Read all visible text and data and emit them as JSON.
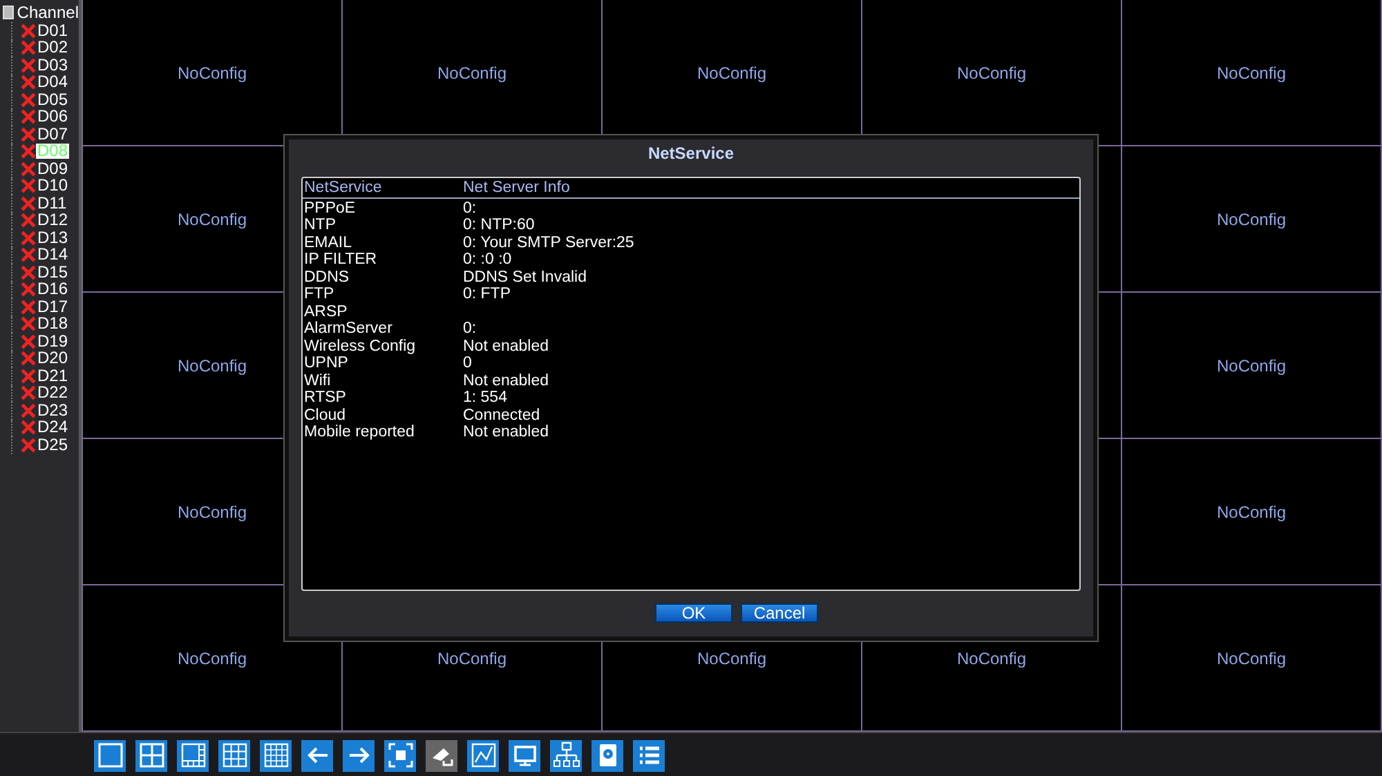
{
  "channel_tree": {
    "title": "Channel",
    "items": [
      {
        "label": "D01",
        "selected": false
      },
      {
        "label": "D02",
        "selected": false
      },
      {
        "label": "D03",
        "selected": false
      },
      {
        "label": "D04",
        "selected": false
      },
      {
        "label": "D05",
        "selected": false
      },
      {
        "label": "D06",
        "selected": false
      },
      {
        "label": "D07",
        "selected": false
      },
      {
        "label": "D08",
        "selected": true
      },
      {
        "label": "D09",
        "selected": false
      },
      {
        "label": "D10",
        "selected": false
      },
      {
        "label": "D11",
        "selected": false
      },
      {
        "label": "D12",
        "selected": false
      },
      {
        "label": "D13",
        "selected": false
      },
      {
        "label": "D14",
        "selected": false
      },
      {
        "label": "D15",
        "selected": false
      },
      {
        "label": "D16",
        "selected": false
      },
      {
        "label": "D17",
        "selected": false
      },
      {
        "label": "D18",
        "selected": false
      },
      {
        "label": "D19",
        "selected": false
      },
      {
        "label": "D20",
        "selected": false
      },
      {
        "label": "D21",
        "selected": false
      },
      {
        "label": "D22",
        "selected": false
      },
      {
        "label": "D23",
        "selected": false
      },
      {
        "label": "D24",
        "selected": false
      },
      {
        "label": "D25",
        "selected": false
      }
    ]
  },
  "video_grid": {
    "cells": [
      {
        "label": "NoConfig"
      },
      {
        "label": "NoConfig"
      },
      {
        "label": "NoConfig"
      },
      {
        "label": "NoConfig"
      },
      {
        "label": "NoConfig"
      },
      {
        "label": "NoConfig"
      },
      null,
      null,
      {},
      {
        "label": "NoConfig"
      },
      {
        "label": "NoConfig"
      },
      null,
      null,
      {},
      {
        "label": "NoConfig"
      },
      {
        "label": "NoConfig"
      },
      null,
      null,
      {},
      {
        "label": "NoConfig"
      },
      {
        "label": "NoConfig"
      },
      {
        "label": "NoConfig"
      },
      {
        "label": "NoConfig"
      },
      {
        "label": "NoConfig"
      },
      {
        "label": "NoConfig"
      }
    ]
  },
  "toolbar": [
    {
      "disabled": false
    },
    {
      "disabled": false
    },
    {
      "disabled": false
    },
    {
      "disabled": false
    },
    {
      "disabled": false
    },
    {
      "disabled": false
    },
    {
      "disabled": false
    },
    {
      "disabled": false
    },
    {
      "disabled": true
    },
    {
      "disabled": false
    },
    {
      "disabled": false
    },
    {
      "disabled": false
    },
    {
      "disabled": false
    },
    {
      "disabled": false
    }
  ],
  "dialog": {
    "title": "NetService",
    "columns": [
      "NetService",
      "Net Server Info"
    ],
    "rows": [
      {
        "service": "PPPoE",
        "info": "0:"
      },
      {
        "service": "NTP",
        "info": "0: NTP:60"
      },
      {
        "service": "EMAIL",
        "info": "0: Your SMTP Server:25"
      },
      {
        "service": "IP FILTER",
        "info": "0: :0 :0"
      },
      {
        "service": "DDNS",
        "info": "DDNS Set Invalid"
      },
      {
        "service": "FTP",
        "info": "0: FTP"
      },
      {
        "service": "ARSP"
      },
      {
        "service": "AlarmServer",
        "info": "0:"
      },
      {
        "service": "Wireless Config",
        "info": "Not enabled"
      },
      {
        "service": "UPNP",
        "info": "0"
      },
      {
        "service": "Wifi",
        "info": "Not enabled"
      },
      {
        "service": "RTSP",
        "info": "1: 554"
      },
      {
        "service": "Cloud",
        "info": "Connected"
      },
      {
        "service": "Mobile reported",
        "info": "Not enabled"
      }
    ],
    "buttons": [
      "OK",
      "Cancel"
    ]
  }
}
